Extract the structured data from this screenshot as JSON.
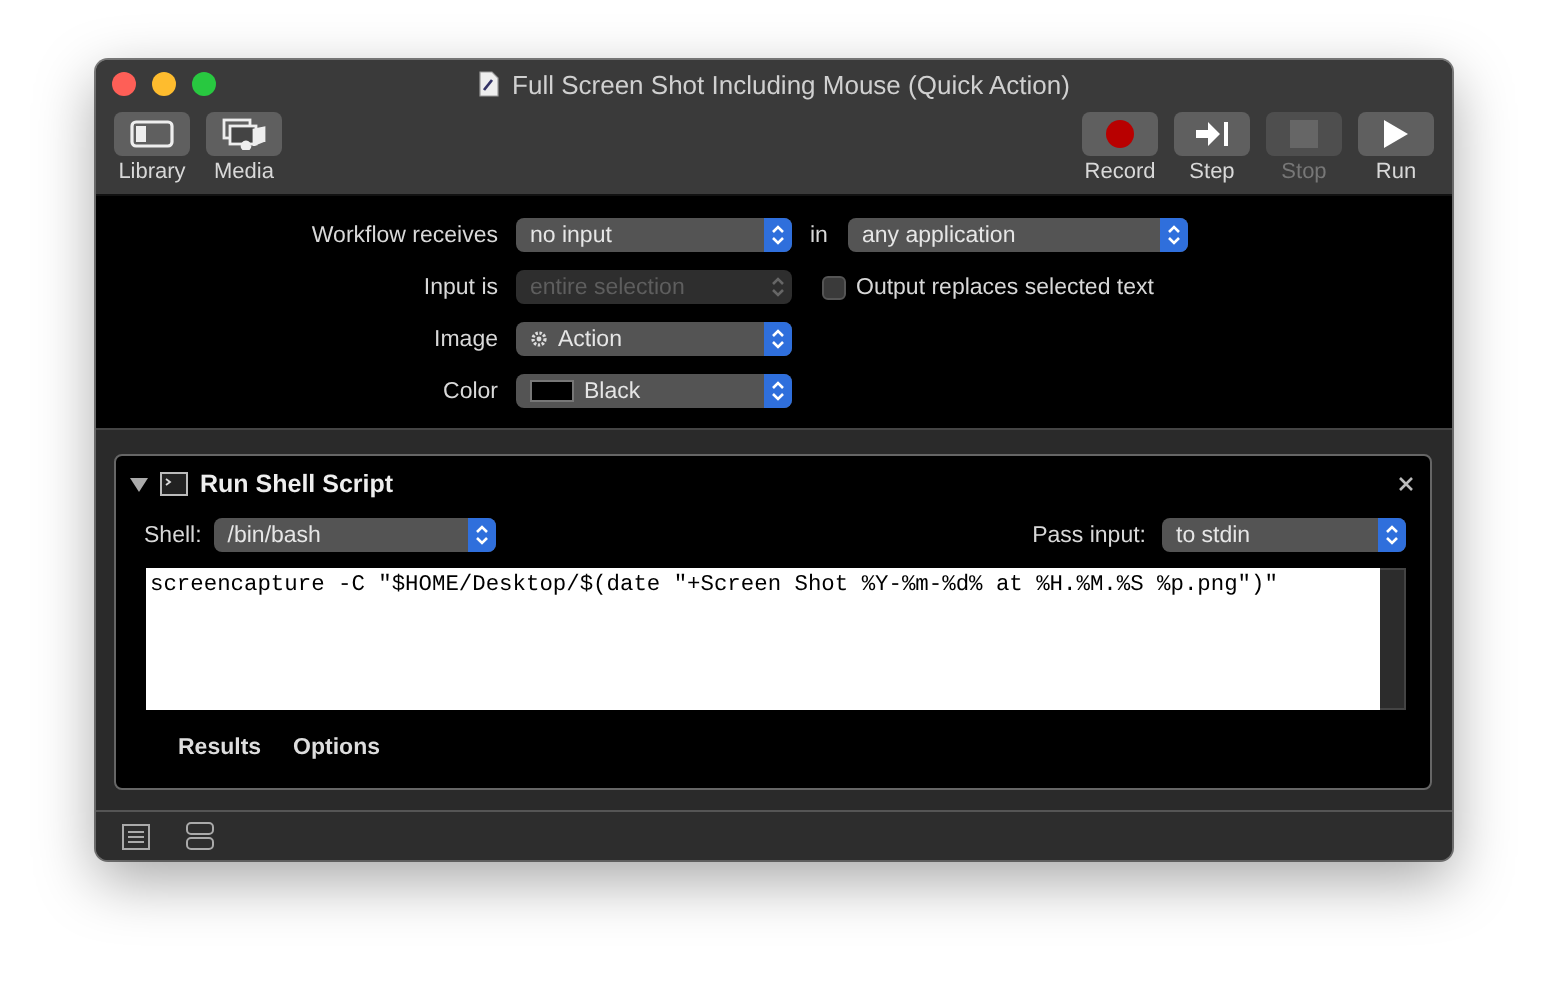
{
  "window": {
    "title": "Full Screen Shot Including Mouse (Quick Action)"
  },
  "toolbar": {
    "left": [
      {
        "label": "Library",
        "kind": "library"
      },
      {
        "label": "Media",
        "kind": "media"
      }
    ],
    "right": [
      {
        "label": "Record",
        "kind": "record",
        "disabled": false
      },
      {
        "label": "Step",
        "kind": "step",
        "disabled": false
      },
      {
        "label": "Stop",
        "kind": "stop",
        "disabled": true
      },
      {
        "label": "Run",
        "kind": "run",
        "disabled": false
      }
    ]
  },
  "workflow": {
    "receives_label": "Workflow receives",
    "receives": "no input",
    "in_label": "in",
    "application": "any application",
    "input_is_label": "Input is",
    "input_is": {
      "value": "entire selection",
      "disabled": true
    },
    "output_replaces": {
      "label": "Output replaces selected text",
      "checked": false
    },
    "image_label": "Image",
    "image": "Action",
    "color_label": "Color",
    "color": {
      "value": "Black",
      "color": "#000000"
    }
  },
  "action": {
    "title": "Run Shell Script",
    "expanded": true,
    "shell_label": "Shell:",
    "shell": "/bin/bash",
    "pass_input_label": "Pass input:",
    "pass_input": "to stdin",
    "script": "screencapture -C \"$HOME/Desktop/$(date \"+Screen Shot %Y-%m-%d% at %H.%M.%S %p.png\")\"",
    "tabs": [
      {
        "label": "Results"
      },
      {
        "label": "Options"
      }
    ]
  }
}
